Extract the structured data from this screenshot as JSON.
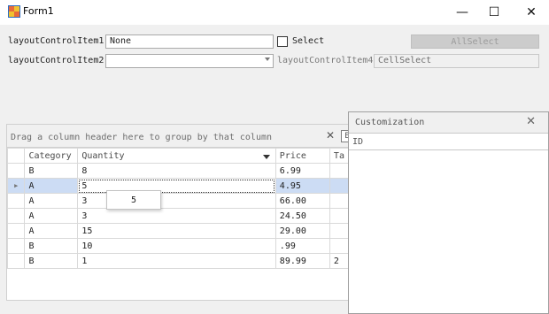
{
  "window": {
    "title": "Form1",
    "controls": {
      "minimize": "—",
      "maximize": "☐",
      "close": "✕"
    }
  },
  "layout": {
    "item1_label": "layoutControlItem1",
    "item1_value": "None",
    "select_label": "Select",
    "allselect_label": "AllSelect",
    "item2_label": "layoutControlItem2",
    "item2_value": "",
    "item4_label": "layoutControlItem4",
    "item4_value": "CellSelect"
  },
  "grid": {
    "group_panel_text": "Drag a column header here to group by that column",
    "group_panel_close": "✕",
    "find_label": "E",
    "columns": [
      "Category",
      "Quantity",
      "Price",
      "Ta"
    ],
    "rows": [
      {
        "indicator": "",
        "category": "B",
        "quantity": "8",
        "price": "6.99",
        "extra": ""
      },
      {
        "indicator": "▶",
        "category": "A",
        "quantity": "5",
        "price": "4.95",
        "extra": ""
      },
      {
        "indicator": "",
        "category": "A",
        "quantity": "3",
        "price": "66.00",
        "extra": ""
      },
      {
        "indicator": "",
        "category": "A",
        "quantity": "3",
        "price": "24.50",
        "extra": ""
      },
      {
        "indicator": "",
        "category": "A",
        "quantity": "15",
        "price": "29.00",
        "extra": ""
      },
      {
        "indicator": "",
        "category": "B",
        "quantity": "10",
        "price": ".99",
        "extra": ""
      },
      {
        "indicator": "",
        "category": "B",
        "quantity": "1",
        "price": "89.99",
        "extra": "2"
      }
    ],
    "editor_popup_value": "5"
  },
  "customization": {
    "title": "Customization",
    "close": "✕",
    "items": [
      "ID"
    ]
  },
  "colors": {
    "focused_row": "#ccdcf4",
    "disabled_button": "#cccccc"
  }
}
